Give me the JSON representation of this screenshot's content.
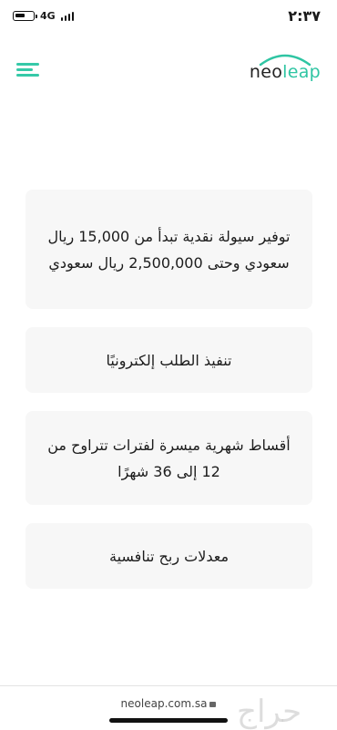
{
  "status_bar": {
    "network": "4G",
    "time": "٢:٣٧"
  },
  "header": {
    "menu_icon": "hamburger-icon",
    "logo": {
      "part1": "neo",
      "part2": "leap",
      "accent": "#2fc5a3"
    }
  },
  "cards": [
    {
      "text": "توفير سيولة نقدية تبدأ من 15,000 ريال سعودي وحتى 2,500,000 ريال سعودي"
    },
    {
      "text": "تنفيذ الطلب إلكترونيًا"
    },
    {
      "text": "أقساط شهرية ميسرة لفترات تتراوح من 12 إلى 36 شهرًا"
    },
    {
      "text": "معدلات ربح تنافسية"
    }
  ],
  "browser": {
    "url": "neoleap.com.sa"
  },
  "watermark": "حراج"
}
